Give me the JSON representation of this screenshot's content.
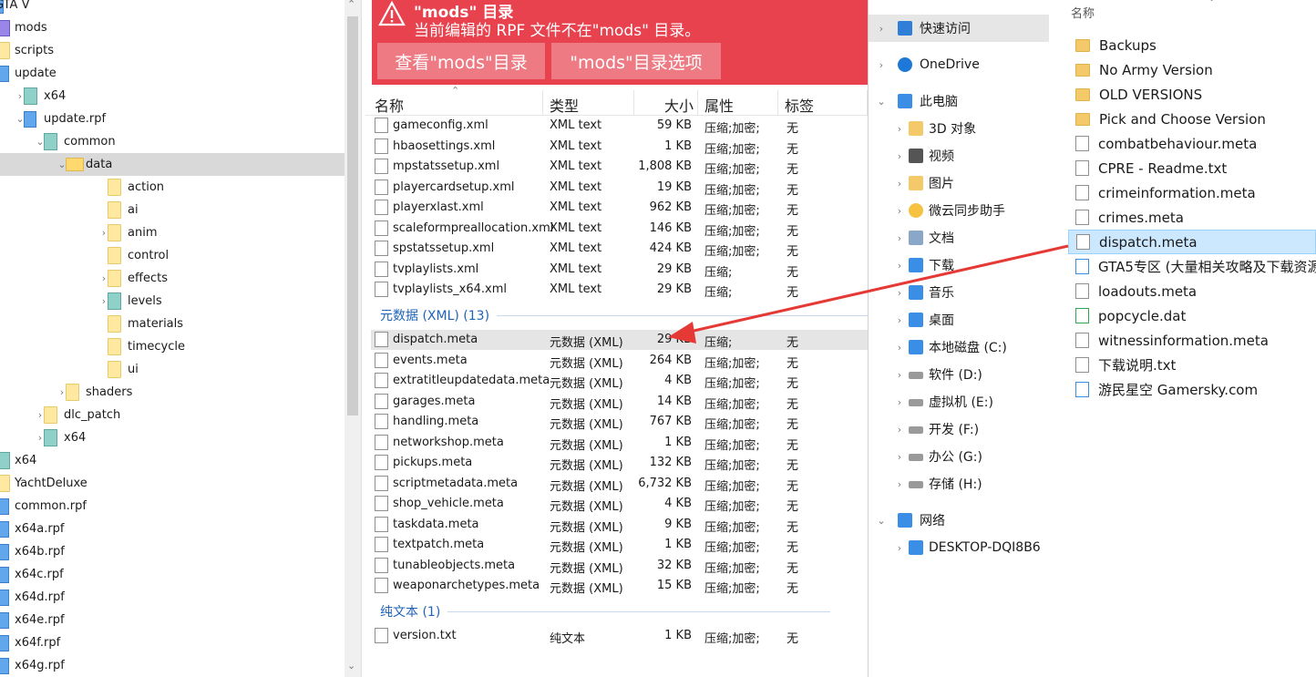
{
  "tree": {
    "items": [
      {
        "label": "GTA V",
        "indent": -8,
        "chev": "",
        "icon": "rpf"
      },
      {
        "label": "mods",
        "indent": 0,
        "chev": "",
        "icon": "rpfp"
      },
      {
        "label": "scripts",
        "indent": 0,
        "chev": "",
        "icon": "folder"
      },
      {
        "label": "update",
        "indent": 0,
        "chev": "",
        "icon": "rpf"
      },
      {
        "label": "x64",
        "indent": 18,
        "chev": "›",
        "icon": "pkg"
      },
      {
        "label": "update.rpf",
        "indent": 18,
        "chev": "⌄",
        "icon": "rpf"
      },
      {
        "label": "common",
        "indent": 40,
        "chev": "⌄",
        "icon": "pkg"
      },
      {
        "label": "data",
        "indent": 64,
        "chev": "⌄",
        "icon": "folder-open",
        "selected": true
      },
      {
        "label": "action",
        "indent": 110,
        "chev": "",
        "icon": "folder"
      },
      {
        "label": "ai",
        "indent": 110,
        "chev": "",
        "icon": "folder"
      },
      {
        "label": "anim",
        "indent": 110,
        "chev": "›",
        "icon": "folder"
      },
      {
        "label": "control",
        "indent": 110,
        "chev": "",
        "icon": "folder"
      },
      {
        "label": "effects",
        "indent": 110,
        "chev": "›",
        "icon": "folder"
      },
      {
        "label": "levels",
        "indent": 110,
        "chev": "›",
        "icon": "pkg"
      },
      {
        "label": "materials",
        "indent": 110,
        "chev": "",
        "icon": "folder"
      },
      {
        "label": "timecycle",
        "indent": 110,
        "chev": "",
        "icon": "folder"
      },
      {
        "label": "ui",
        "indent": 110,
        "chev": "",
        "icon": "folder"
      },
      {
        "label": "shaders",
        "indent": 64,
        "chev": "›",
        "icon": "folder"
      },
      {
        "label": "dlc_patch",
        "indent": 40,
        "chev": "›",
        "icon": "folder"
      },
      {
        "label": "x64",
        "indent": 40,
        "chev": "›",
        "icon": "pkg"
      },
      {
        "label": "x64",
        "indent": 0,
        "chev": "",
        "icon": "pkg"
      },
      {
        "label": "YachtDeluxe",
        "indent": 0,
        "chev": "",
        "icon": "folder"
      },
      {
        "label": "common.rpf",
        "indent": 0,
        "chev": "",
        "icon": "rpf"
      },
      {
        "label": "x64a.rpf",
        "indent": 0,
        "chev": "",
        "icon": "rpf"
      },
      {
        "label": "x64b.rpf",
        "indent": 0,
        "chev": "",
        "icon": "rpf"
      },
      {
        "label": "x64c.rpf",
        "indent": 0,
        "chev": "",
        "icon": "rpf"
      },
      {
        "label": "x64d.rpf",
        "indent": 0,
        "chev": "",
        "icon": "rpf"
      },
      {
        "label": "x64e.rpf",
        "indent": 0,
        "chev": "",
        "icon": "rpf"
      },
      {
        "label": "x64f.rpf",
        "indent": 0,
        "chev": "",
        "icon": "rpf"
      },
      {
        "label": "x64g.rpf",
        "indent": 0,
        "chev": "",
        "icon": "rpf"
      }
    ]
  },
  "banner": {
    "title": "\"mods\" 目录",
    "message": "当前编辑的 RPF 文件不在\"mods\" 目录。",
    "btn_view": "查看\"mods\"目录",
    "btn_options": "\"mods\"目录选项"
  },
  "columns": {
    "name": "名称",
    "type": "类型",
    "size": "大小",
    "attr": "属性",
    "tag": "标签"
  },
  "xml_files": [
    {
      "name": "gameconfig.xml",
      "type": "XML text",
      "size": "59 KB",
      "attr": "压缩;加密;",
      "tag": "无"
    },
    {
      "name": "hbaosettings.xml",
      "type": "XML text",
      "size": "1 KB",
      "attr": "压缩;加密;",
      "tag": "无"
    },
    {
      "name": "mpstatssetup.xml",
      "type": "XML text",
      "size": "1,808 KB",
      "attr": "压缩;加密;",
      "tag": "无"
    },
    {
      "name": "playercardsetup.xml",
      "type": "XML text",
      "size": "19 KB",
      "attr": "压缩;加密;",
      "tag": "无"
    },
    {
      "name": "playerxlast.xml",
      "type": "XML text",
      "size": "962 KB",
      "attr": "压缩;加密;",
      "tag": "无"
    },
    {
      "name": "scaleformpreallocation.xml",
      "type": "XML text",
      "size": "146 KB",
      "attr": "压缩;加密;",
      "tag": "无"
    },
    {
      "name": "spstatssetup.xml",
      "type": "XML text",
      "size": "424 KB",
      "attr": "压缩;加密;",
      "tag": "无"
    },
    {
      "name": "tvplaylists.xml",
      "type": "XML text",
      "size": "29 KB",
      "attr": "压缩;",
      "tag": "无"
    },
    {
      "name": "tvplaylists_x64.xml",
      "type": "XML text",
      "size": "29 KB",
      "attr": "压缩;",
      "tag": "无"
    }
  ],
  "group_meta": "元数据 (XML) (13)",
  "meta_files": [
    {
      "name": "dispatch.meta",
      "type": "元数据 (XML)",
      "size": "29 KB",
      "attr": "压缩;",
      "tag": "无",
      "highlight": true
    },
    {
      "name": "events.meta",
      "type": "元数据 (XML)",
      "size": "264 KB",
      "attr": "压缩;加密;",
      "tag": "无"
    },
    {
      "name": "extratitleupdatedata.meta",
      "type": "元数据 (XML)",
      "size": "4 KB",
      "attr": "压缩;加密;",
      "tag": "无"
    },
    {
      "name": "garages.meta",
      "type": "元数据 (XML)",
      "size": "14 KB",
      "attr": "压缩;加密;",
      "tag": "无"
    },
    {
      "name": "handling.meta",
      "type": "元数据 (XML)",
      "size": "767 KB",
      "attr": "压缩;加密;",
      "tag": "无"
    },
    {
      "name": "networkshop.meta",
      "type": "元数据 (XML)",
      "size": "1 KB",
      "attr": "压缩;加密;",
      "tag": "无"
    },
    {
      "name": "pickups.meta",
      "type": "元数据 (XML)",
      "size": "132 KB",
      "attr": "压缩;加密;",
      "tag": "无"
    },
    {
      "name": "scriptmetadata.meta",
      "type": "元数据 (XML)",
      "size": "6,732 KB",
      "attr": "压缩;加密;",
      "tag": "无"
    },
    {
      "name": "shop_vehicle.meta",
      "type": "元数据 (XML)",
      "size": "4 KB",
      "attr": "压缩;加密;",
      "tag": "无"
    },
    {
      "name": "taskdata.meta",
      "type": "元数据 (XML)",
      "size": "9 KB",
      "attr": "压缩;加密;",
      "tag": "无"
    },
    {
      "name": "textpatch.meta",
      "type": "元数据 (XML)",
      "size": "1 KB",
      "attr": "压缩;加密;",
      "tag": "无"
    },
    {
      "name": "tunableobjects.meta",
      "type": "元数据 (XML)",
      "size": "32 KB",
      "attr": "压缩;加密;",
      "tag": "无"
    },
    {
      "name": "weaponarchetypes.meta",
      "type": "元数据 (XML)",
      "size": "15 KB",
      "attr": "压缩;加密;",
      "tag": "无"
    }
  ],
  "group_text": "纯文本 (1)",
  "text_files": [
    {
      "name": "version.txt",
      "type": "纯文本",
      "size": "1 KB",
      "attr": "压缩;加密;",
      "tag": "无"
    }
  ],
  "nav": [
    {
      "label": "快速访问",
      "icon": "star",
      "level": 0,
      "chev": "›",
      "selected": true
    },
    {
      "label": "OneDrive",
      "icon": "cloud",
      "level": 0,
      "chev": "›"
    },
    {
      "label": "此电脑",
      "icon": "pc",
      "level": 0,
      "chev": "⌄"
    },
    {
      "label": "3D 对象",
      "icon": "folder",
      "level": 1,
      "chev": "›"
    },
    {
      "label": "视频",
      "icon": "video",
      "level": 1,
      "chev": "›"
    },
    {
      "label": "图片",
      "icon": "folder",
      "level": 1,
      "chev": "›"
    },
    {
      "label": "微云同步助手",
      "icon": "weiyun",
      "level": 1,
      "chev": "›"
    },
    {
      "label": "文档",
      "icon": "docs",
      "level": 1,
      "chev": "›"
    },
    {
      "label": "下载",
      "icon": "download",
      "level": 1,
      "chev": "›"
    },
    {
      "label": "音乐",
      "icon": "music",
      "level": 1,
      "chev": "›"
    },
    {
      "label": "桌面",
      "icon": "desktop",
      "level": 1,
      "chev": "›"
    },
    {
      "label": "本地磁盘 (C:)",
      "icon": "windrive",
      "level": 1,
      "chev": "›"
    },
    {
      "label": "软件 (D:)",
      "icon": "drive",
      "level": 1,
      "chev": "›"
    },
    {
      "label": "虚拟机 (E:)",
      "icon": "drive",
      "level": 1,
      "chev": "›"
    },
    {
      "label": "开发 (F:)",
      "icon": "drive",
      "level": 1,
      "chev": "›"
    },
    {
      "label": "办公 (G:)",
      "icon": "drive",
      "level": 1,
      "chev": "›"
    },
    {
      "label": "存储 (H:)",
      "icon": "drive",
      "level": 1,
      "chev": "›"
    },
    {
      "label": "网络",
      "icon": "network",
      "level": 0,
      "chev": "⌄"
    },
    {
      "label": "DESKTOP-DQI8B6",
      "icon": "pc",
      "level": 1,
      "chev": "›"
    }
  ],
  "right_header": "名称",
  "right_files": [
    {
      "name": "Backups",
      "icon": "folder"
    },
    {
      "name": "No Army Version",
      "icon": "folder"
    },
    {
      "name": "OLD VERSIONS",
      "icon": "folder"
    },
    {
      "name": "Pick and Choose Version",
      "icon": "folder"
    },
    {
      "name": "combatbehaviour.meta",
      "icon": "doc"
    },
    {
      "name": "CPRE - Readme.txt",
      "icon": "txt"
    },
    {
      "name": "crimeinformation.meta",
      "icon": "doc"
    },
    {
      "name": "crimes.meta",
      "icon": "doc"
    },
    {
      "name": "dispatch.meta",
      "icon": "doc",
      "selected": true
    },
    {
      "name": "GTA5专区 (大量相关攻略及下载资源",
      "icon": "link"
    },
    {
      "name": "loadouts.meta",
      "icon": "doc"
    },
    {
      "name": "popcycle.dat",
      "icon": "dat"
    },
    {
      "name": "witnessinformation.meta",
      "icon": "doc"
    },
    {
      "name": "下载说明.txt",
      "icon": "txt"
    },
    {
      "name": "游民星空 Gamersky.com",
      "icon": "link"
    }
  ],
  "colors": {
    "banner": "#e8424f",
    "button": "#ee7a83",
    "group": "#1e63b8",
    "arrow": "#e53935",
    "selection": "#cce8ff"
  }
}
